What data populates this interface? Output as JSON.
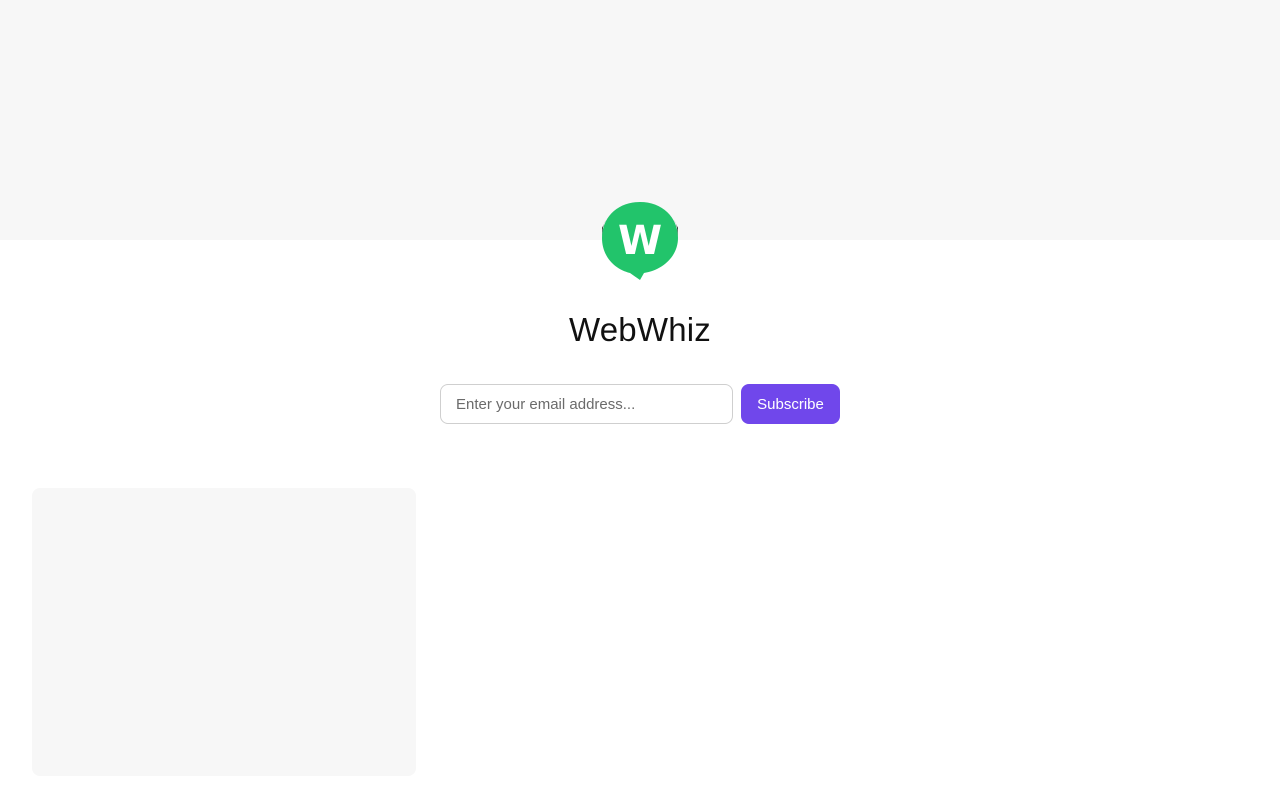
{
  "publication": {
    "name": "WebWhiz",
    "logo_letter": "W",
    "logo_icon": "webwhiz-logo-icon",
    "brand_color": "#22c46b"
  },
  "subscribe": {
    "email_placeholder": "Enter your email address...",
    "button_label": "Subscribe",
    "button_color": "#7047eb"
  }
}
